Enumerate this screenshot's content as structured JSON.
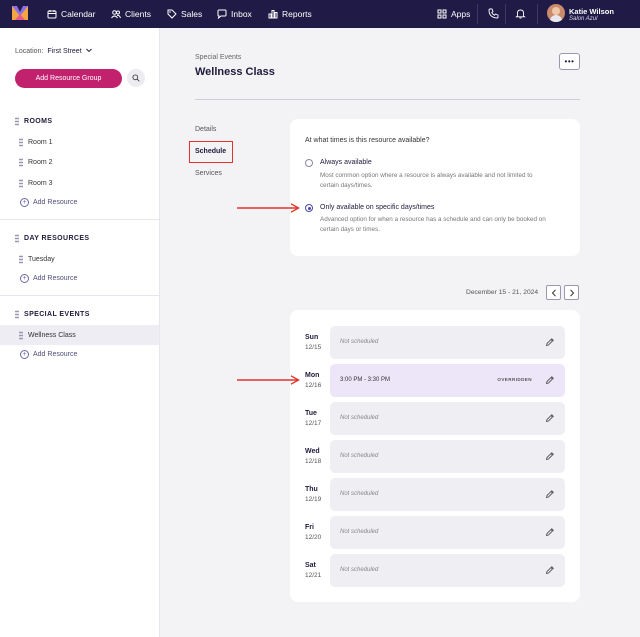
{
  "nav": {
    "items": [
      {
        "label": "Calendar",
        "icon": "calendar-icon"
      },
      {
        "label": "Clients",
        "icon": "clients-icon"
      },
      {
        "label": "Sales",
        "icon": "tag-icon"
      },
      {
        "label": "Inbox",
        "icon": "chat-icon"
      },
      {
        "label": "Reports",
        "icon": "bar-chart-icon"
      }
    ],
    "apps_label": "Apps",
    "user_name": "Katie Wilson",
    "user_location": "Salon Azul"
  },
  "sidebar": {
    "location_label": "Location:",
    "location_value": "First Street",
    "add_group_label": "Add Resource Group",
    "add_resource_label": "Add Resource",
    "sections": [
      {
        "title": "ROOMS",
        "items": [
          "Room 1",
          "Room 2",
          "Room 3"
        ]
      },
      {
        "title": "DAY RESOURCES",
        "items": [
          "Tuesday"
        ]
      },
      {
        "title": "SPECIAL EVENTS",
        "items": [
          "Wellness Class"
        ]
      }
    ]
  },
  "main": {
    "breadcrumb": "Special Events",
    "title": "Wellness Class",
    "more_label": "•••",
    "tabs": [
      "Details",
      "Schedule",
      "Services"
    ],
    "question": "At what times is this resource available?",
    "options": [
      {
        "title": "Always available",
        "desc": "Most common option where a resource is always available and not limited to certain days/times."
      },
      {
        "title": "Only available on specific days/times",
        "desc": "Advanced option for when a resource has a schedule and can only be booked on certain days or times."
      }
    ],
    "week_range": "December 15 - 21, 2024",
    "days": [
      {
        "day": "Sun",
        "date": "12/15",
        "slot": "Not scheduled",
        "badge": ""
      },
      {
        "day": "Mon",
        "date": "12/16",
        "slot": "3:00 PM - 3:30 PM",
        "badge": "OVERRIDDEN"
      },
      {
        "day": "Tue",
        "date": "12/17",
        "slot": "Not scheduled",
        "badge": ""
      },
      {
        "day": "Wed",
        "date": "12/18",
        "slot": "Not scheduled",
        "badge": ""
      },
      {
        "day": "Thu",
        "date": "12/19",
        "slot": "Not scheduled",
        "badge": ""
      },
      {
        "day": "Fri",
        "date": "12/20",
        "slot": "Not scheduled",
        "badge": ""
      },
      {
        "day": "Sat",
        "date": "12/21",
        "slot": "Not scheduled",
        "badge": ""
      }
    ]
  },
  "colors": {
    "nav_bg": "#1f1b46",
    "primary_button": "#c2216e",
    "annotation_red": "#e0352b",
    "overridden_slot": "#ece6f8"
  }
}
